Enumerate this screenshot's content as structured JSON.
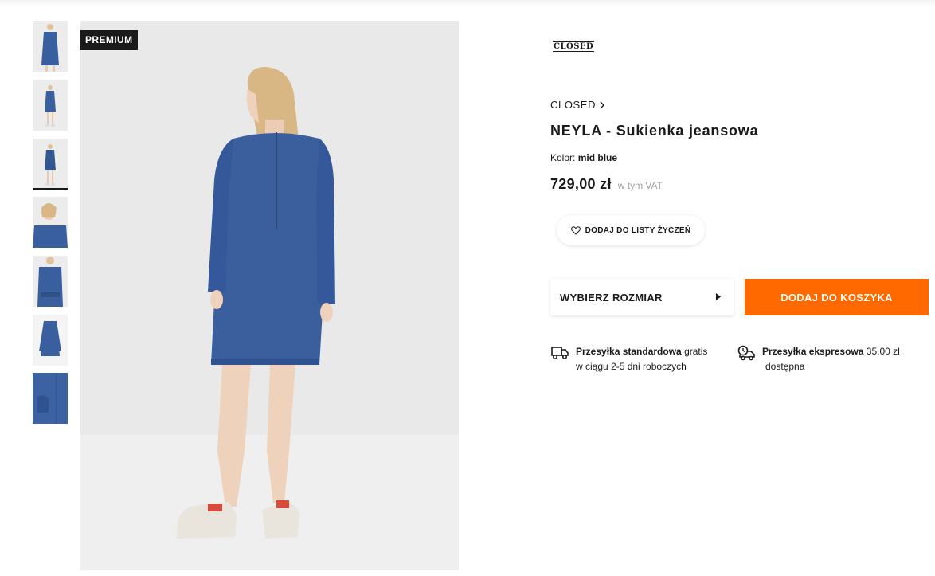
{
  "badge": {
    "premium": "PREMIUM"
  },
  "brand": {
    "logo_text": "CLOSED",
    "link_label": "CLOSED"
  },
  "product": {
    "title": "NEYLA - Sukienka jeansowa",
    "color_label": "Kolor:",
    "color_value": "mid blue",
    "price": "729,00 zł",
    "vat_note": "w tym VAT"
  },
  "actions": {
    "wishlist_label": "DODAJ DO LISTY ŻYCZEŃ",
    "size_label": "WYBIERZ ROZMIAR",
    "add_to_cart_label": "DODAJ DO KOSZYKA"
  },
  "shipping": {
    "standard_title": "Przesyłka standardowa",
    "standard_price": "gratis",
    "standard_detail": "w ciągu 2-5 dni roboczych",
    "express_title": "Przesyłka ekspresowa",
    "express_price": "35,00 zł",
    "express_detail": "dostępna"
  },
  "thumbnails": {
    "count": 7,
    "active_index": 2
  },
  "colors": {
    "accent": "#ff6900",
    "denim": "#3a5f9e",
    "badge_bg": "#1a1a1a",
    "image_bg": "#e8e8e8"
  },
  "icons": [
    "chevron-right-icon",
    "heart-icon",
    "triangle-right-icon",
    "truck-icon",
    "express-truck-icon"
  ]
}
